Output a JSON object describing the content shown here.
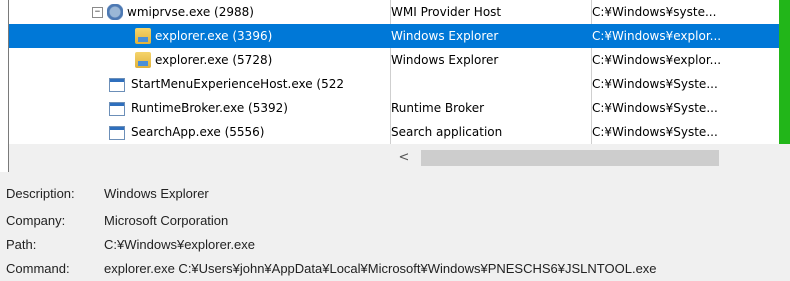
{
  "process_tree": {
    "rows": [
      {
        "name": "wmiprvse.exe (2988)",
        "description": "WMI Provider Host",
        "path": "C:¥Windows¥syste...",
        "selected": false,
        "toggle": "−",
        "icon": "wmi-folder-icon"
      },
      {
        "name": "explorer.exe (3396)",
        "description": "Windows Explorer",
        "path": "C:¥Windows¥explor...",
        "selected": true,
        "icon": "explorer-folder-icon"
      },
      {
        "name": "explorer.exe (5728)",
        "description": "Windows Explorer",
        "path": "C:¥Windows¥explor...",
        "selected": false,
        "icon": "explorer-folder-icon"
      },
      {
        "name": "StartMenuExperienceHost.exe (522",
        "description": "",
        "path": "C:¥Windows¥Syste...",
        "selected": false,
        "icon": "app-window-icon"
      },
      {
        "name": "RuntimeBroker.exe (5392)",
        "description": "Runtime Broker",
        "path": "C:¥Windows¥Syste...",
        "selected": false,
        "icon": "app-window-icon"
      },
      {
        "name": "SearchApp.exe (5556)",
        "description": "Search application",
        "path": "C:¥Windows¥Syste...",
        "selected": false,
        "icon": "app-window-icon"
      }
    ],
    "scroll_left_glyph": "<",
    "status_color": "#22b619",
    "selection_color": "#0078d7"
  },
  "details": {
    "description_label": "Description:",
    "description_value": "Windows Explorer",
    "company_label": "Company:",
    "company_value": "Microsoft Corporation",
    "path_label": "Path:",
    "path_value": "C:¥Windows¥explorer.exe",
    "command_label": "Command:",
    "command_value": "explorer.exe C:¥Users¥john¥AppData¥Local¥Microsoft¥Windows¥PNESCHS6¥JSLNTOOL.exe"
  }
}
